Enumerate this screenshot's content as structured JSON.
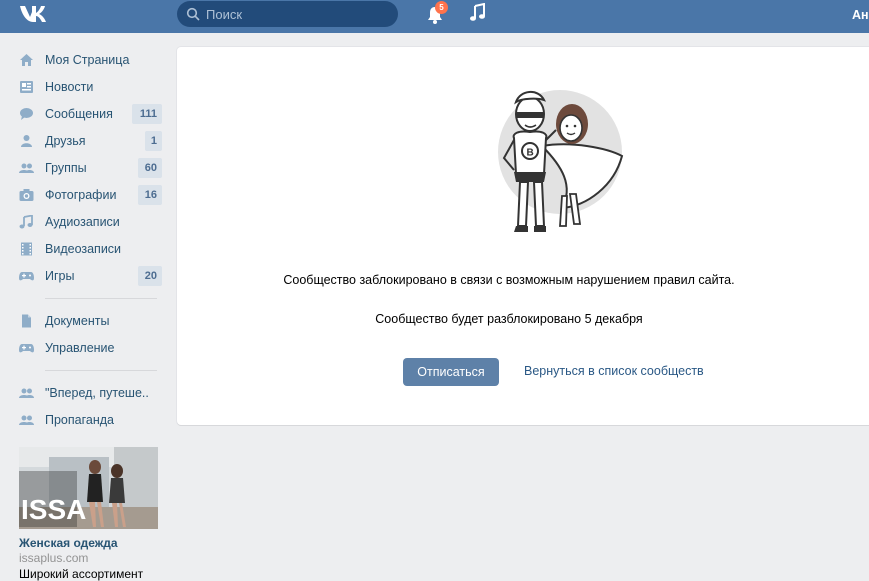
{
  "header": {
    "logo": "VK",
    "search_placeholder": "Поиск",
    "notifications_count": "5",
    "user_name": "Ан"
  },
  "menu": {
    "items": [
      {
        "label": "Моя Страница",
        "icon": "home-icon"
      },
      {
        "label": "Новости",
        "icon": "news-icon"
      },
      {
        "label": "Сообщения",
        "icon": "messages-icon",
        "count": "111"
      },
      {
        "label": "Друзья",
        "icon": "friends-icon",
        "count": "1"
      },
      {
        "label": "Группы",
        "icon": "groups-icon",
        "count": "60"
      },
      {
        "label": "Фотографии",
        "icon": "camera-icon",
        "count": "16"
      },
      {
        "label": "Аудиозаписи",
        "icon": "music-icon"
      },
      {
        "label": "Видеозаписи",
        "icon": "video-icon"
      },
      {
        "label": "Игры",
        "icon": "games-icon",
        "count": "20"
      }
    ],
    "extra_items": [
      {
        "label": "Документы",
        "icon": "document-icon"
      },
      {
        "label": "Управление",
        "icon": "gamepad-icon"
      }
    ],
    "groups": [
      {
        "label": "\"Вперед, путеше..",
        "icon": "group-icon"
      },
      {
        "label": "Пропаганда",
        "icon": "group-icon"
      }
    ]
  },
  "ad": {
    "title": "Женская одежда",
    "domain": "issaplus.com",
    "description": "Широкий ассортимент",
    "logo_text": "ISSA"
  },
  "main": {
    "blocked_message": "Сообщество заблокировано в связи с возможным нарушением правил сайта.",
    "unblock_message": "Сообщество будет разблокировано 5 декабря",
    "unsubscribe_button": "Отписаться",
    "back_link": "Вернуться в список сообществ"
  },
  "colors": {
    "header": "#4a76a8",
    "link": "#2a5885",
    "button": "#5e81a8",
    "badge": "#ff734c"
  }
}
